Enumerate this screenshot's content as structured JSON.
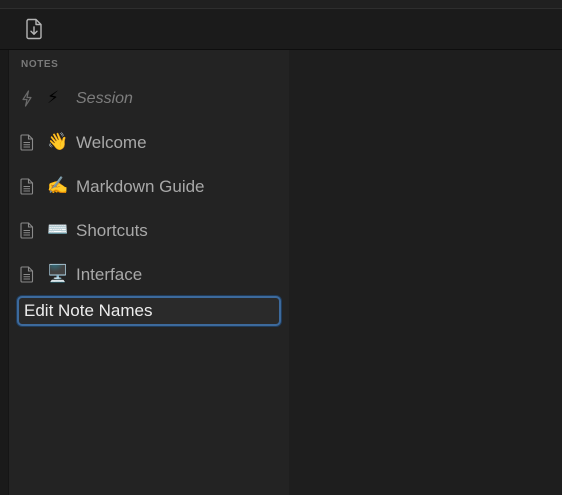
{
  "toolbar": {
    "export_icon": "file-download-icon"
  },
  "sidebar": {
    "section_label": "NOTES",
    "items": [
      {
        "emoji": "⚡",
        "label": "Session",
        "icon": "bolt-icon",
        "kind": "session"
      },
      {
        "emoji": "👋",
        "label": "Welcome",
        "icon": "document-icon",
        "kind": "note"
      },
      {
        "emoji": "✍️",
        "label": "Markdown Guide",
        "icon": "document-icon",
        "kind": "note"
      },
      {
        "emoji": "⌨️",
        "label": "Shortcuts",
        "icon": "document-icon",
        "kind": "note"
      },
      {
        "emoji": "🖥️",
        "label": "Interface",
        "icon": "document-icon",
        "kind": "note"
      }
    ],
    "edit_field_value": "Edit Note Names"
  },
  "colors": {
    "background": "#1e1e1e",
    "sidebar": "#232323",
    "focus_ring": "#3d6a9c",
    "text": "#a8a8a8"
  }
}
